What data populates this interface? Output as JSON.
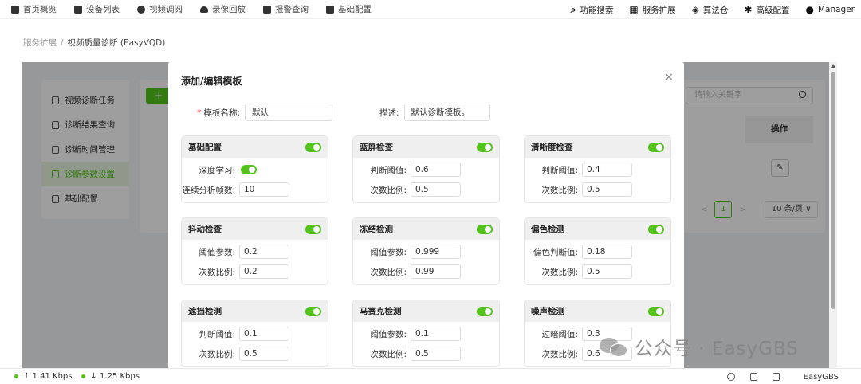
{
  "nav": {
    "items": [
      {
        "icon": "home-icon",
        "label": "首页概览"
      },
      {
        "icon": "camera-icon",
        "label": "设备列表"
      },
      {
        "icon": "play-icon",
        "label": "视频调阅"
      },
      {
        "icon": "cloud-icon",
        "label": "录像回放"
      },
      {
        "icon": "alarm-icon",
        "label": "报警查询"
      },
      {
        "icon": "pen-icon",
        "label": "基础配置"
      }
    ],
    "right": [
      {
        "icon": "search-icon",
        "glyph": "⌕",
        "label": "功能搜索"
      },
      {
        "icon": "grid-icon",
        "glyph": "▦",
        "label": "服务扩展"
      },
      {
        "icon": "dropbox-icon",
        "glyph": "◈",
        "label": "算法仓"
      },
      {
        "icon": "gear-icon",
        "glyph": "✱",
        "label": "高级配置"
      },
      {
        "icon": "user-icon",
        "glyph": "●",
        "label": "Manager"
      }
    ]
  },
  "breadcrumb": {
    "parent": "服务扩展",
    "separator": "/",
    "current": "视频质量诊断 (EasyVQD)"
  },
  "sidebar": {
    "items": [
      {
        "label": "视频诊断任务",
        "active": false
      },
      {
        "label": "诊断结果查询",
        "active": false
      },
      {
        "label": "诊断时间管理",
        "active": false
      },
      {
        "label": "诊断参数设置",
        "active": true
      },
      {
        "label": "基础配置",
        "active": false
      }
    ]
  },
  "bg": {
    "add_label": "+",
    "search_placeholder": "请输入关键字",
    "column_action": "操作",
    "page": "1",
    "page_size": "10 条/页 ∨",
    "prev": "<",
    "next": ">"
  },
  "modal": {
    "title": "添加/编辑模板",
    "close": "×",
    "name_label": "模板名称:",
    "name_required": "*",
    "name_value": "默认",
    "desc_label": "描述:",
    "desc_value": "默认诊断模板。",
    "cards": [
      {
        "title": "基础配置",
        "enabled": true,
        "rows": [
          {
            "label": "深度学习:",
            "type": "toggle",
            "value": true
          },
          {
            "label": "连续分析帧数:",
            "type": "input",
            "value": "10"
          }
        ]
      },
      {
        "title": "蓝屏检查",
        "enabled": true,
        "rows": [
          {
            "label": "判断阈值:",
            "type": "input",
            "value": "0.6"
          },
          {
            "label": "次数比例:",
            "type": "input",
            "value": "0.5"
          }
        ]
      },
      {
        "title": "清晰度检查",
        "enabled": true,
        "rows": [
          {
            "label": "判断阈值:",
            "type": "input",
            "value": "0.4"
          },
          {
            "label": "次数比例:",
            "type": "input",
            "value": "0.5"
          }
        ]
      },
      {
        "title": "抖动检查",
        "enabled": true,
        "rows": [
          {
            "label": "阈值参数:",
            "type": "input",
            "value": "0.2"
          },
          {
            "label": "次数比例:",
            "type": "input",
            "value": "0.2"
          }
        ]
      },
      {
        "title": "冻结检测",
        "enabled": true,
        "rows": [
          {
            "label": "阈值参数:",
            "type": "input",
            "value": "0.999"
          },
          {
            "label": "次数比例:",
            "type": "input",
            "value": "0.99"
          }
        ]
      },
      {
        "title": "偏色检测",
        "enabled": true,
        "rows": [
          {
            "label": "偏色判断值:",
            "type": "input",
            "value": "0.18"
          },
          {
            "label": "次数比例:",
            "type": "input",
            "value": "0.5"
          }
        ]
      },
      {
        "title": "遮挡检测",
        "enabled": true,
        "rows": [
          {
            "label": "判断阈值:",
            "type": "input",
            "value": "0.1"
          },
          {
            "label": "次数比例:",
            "type": "input",
            "value": "0.5"
          }
        ]
      },
      {
        "title": "马赛克检测",
        "enabled": true,
        "rows": [
          {
            "label": "阈值参数:",
            "type": "input",
            "value": "0.1"
          },
          {
            "label": "次数比例:",
            "type": "input",
            "value": "0.5"
          }
        ]
      },
      {
        "title": "噪声检测",
        "enabled": true,
        "rows": [
          {
            "label": "过暗阈值:",
            "type": "input",
            "value": "0.3"
          },
          {
            "label": "次数比例:",
            "type": "input",
            "value": "0.6"
          }
        ]
      }
    ]
  },
  "watermark": {
    "text": "公众号 · EasyGBS"
  },
  "status": {
    "upload": "↑ 1.41 Kbps",
    "download": "↓ 1.25 Kbps",
    "brand": "EasyGBS"
  },
  "colors": {
    "accent": "#52c41a"
  }
}
